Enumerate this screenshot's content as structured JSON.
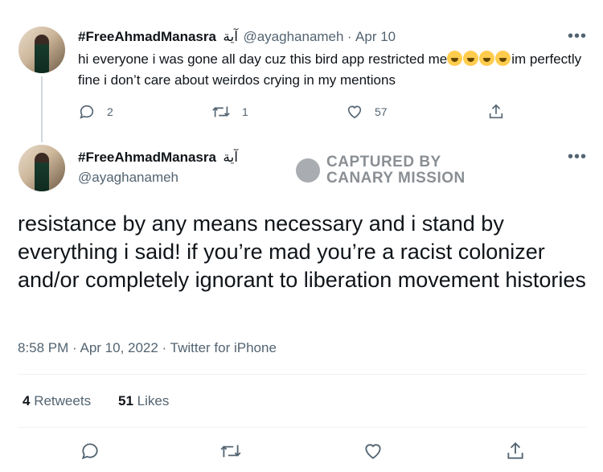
{
  "reply_tweet": {
    "display_name": "#FreeAhmadManasra",
    "name_suffix": "آية",
    "handle": "@ayaghanameh",
    "separator": "·",
    "date": "Apr 10",
    "more_label": "•••",
    "text_before": "hi everyone i was gone all day cuz this bird app restricted me",
    "text_after": "im perfectly fine i don’t care about weirdos crying in my mentions",
    "emoji_count": 4,
    "emoji_icon": "rolling-on-floor-laughing-icon",
    "actions": {
      "reply_count": "2",
      "retweet_count": "1",
      "like_count": "57"
    }
  },
  "main_tweet": {
    "display_name": "#FreeAhmadManasra",
    "name_suffix": "آية",
    "handle": "@ayaghanameh",
    "more_label": "•••",
    "text": "resistance by any means necessary and i stand by everything i said! if you’re mad you’re a racist colonizer and/or completely ignorant to liberation movement histories",
    "timestamp": "8:58 PM · Apr 10, 2022 · Twitter for iPhone",
    "retweets_count": "4",
    "retweets_label": "Retweets",
    "likes_count": "51",
    "likes_label": "Likes"
  },
  "watermark": {
    "line1": "CAPTURED BY",
    "line2": "CANARY MISSION"
  },
  "colors": {
    "text": "#0f1419",
    "muted": "#536471",
    "divider": "#eff3f4",
    "thread_line": "#cfd9de"
  }
}
